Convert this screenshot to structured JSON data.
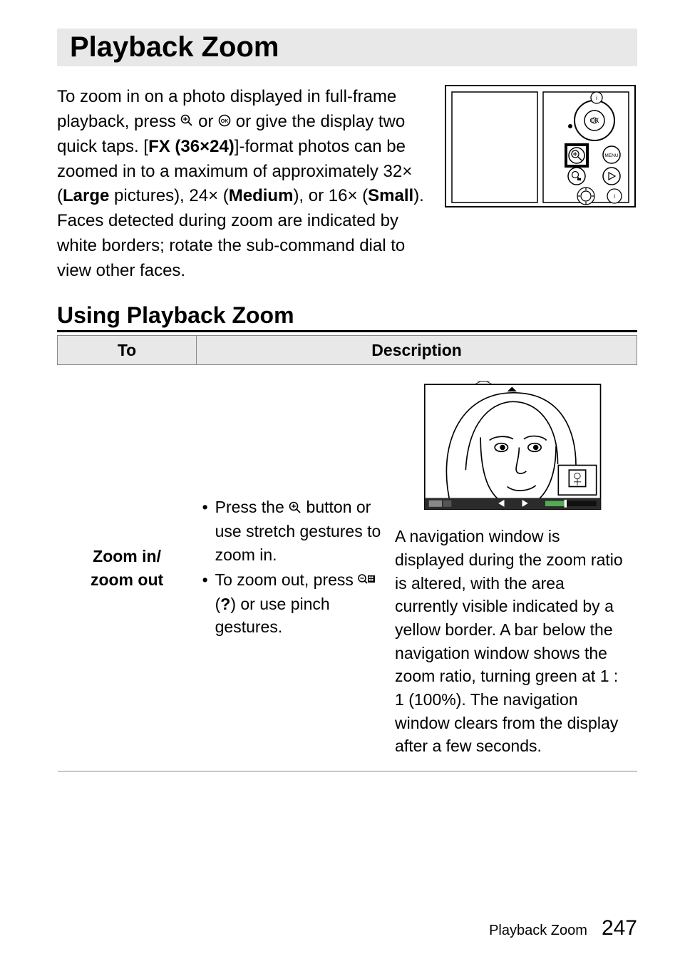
{
  "main_title": "Playback Zoom",
  "intro": {
    "l1": "To zoom in on a photo displayed in full-frame playback, press ",
    "l2": " or ",
    "l3": " or give the display two quick taps. [",
    "fx": "FX (36×24)",
    "l4": "]-format photos can be zoomed in to a maximum of approximately 32× (",
    "large": "Large",
    "l5": " pictures), 24× (",
    "medium": "Medium",
    "l6": "), or 16× (",
    "small": "Small",
    "l7": "). Faces detected during zoom are indicated by white borders; rotate the sub-command dial to view other faces."
  },
  "section_title": "Using Playback Zoom",
  "table": {
    "head_to": "To",
    "head_desc": "Description",
    "row1": {
      "label1": "Zoom in/",
      "label2": "zoom out",
      "b1a": "Press the ",
      "b1b": " button or use stretch gestures to zoom in.",
      "b2a": "To zoom out, press ",
      "b2b": " (",
      "q": "?",
      "b2c": ") or use pinch gestures.",
      "right": "A navigation window is displayed during the zoom ratio is altered, with the area currently visible indicated by a yellow border. A bar below the navigation window shows the zoom ratio, turning green at 1 : 1 (100%). The navigation window clears from the display after a few seconds."
    }
  },
  "footer": {
    "label": "Playback Zoom",
    "page": "247"
  }
}
